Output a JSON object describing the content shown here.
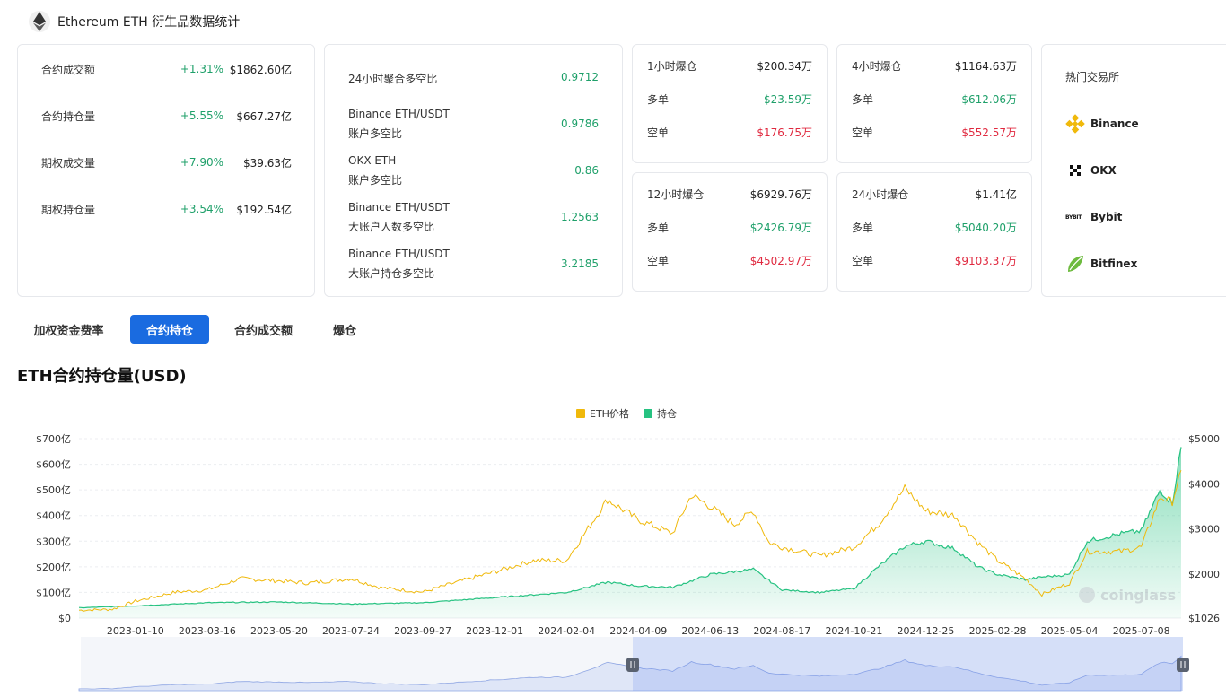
{
  "header": {
    "title": "Ethereum ETH 衍生品数据统计"
  },
  "stats": [
    {
      "label": "合约成交额",
      "change": "+1.31%",
      "value": "$1862.60亿"
    },
    {
      "label": "合约持仓量",
      "change": "+5.55%",
      "value": "$667.27亿"
    },
    {
      "label": "期权成交量",
      "change": "+7.90%",
      "value": "$39.63亿"
    },
    {
      "label": "期权持仓量",
      "change": "+3.54%",
      "value": "$192.54亿"
    }
  ],
  "ratios": [
    {
      "line1": "24小时聚合多空比",
      "line2": "",
      "value": "0.9712"
    },
    {
      "line1": "Binance ETH/USDT",
      "line2": "账户多空比",
      "value": "0.9786"
    },
    {
      "line1": "OKX ETH",
      "line2": "账户多空比",
      "value": "0.86"
    },
    {
      "line1": "Binance ETH/USDT",
      "line2": "大账户人数多空比",
      "value": "1.2563"
    },
    {
      "line1": "Binance ETH/USDT",
      "line2": "大账户持仓多空比",
      "value": "3.2185"
    }
  ],
  "liquidations": [
    {
      "title": "1小时爆仓",
      "total": "$200.34万",
      "long_label": "多单",
      "long": "$23.59万",
      "short_label": "空单",
      "short": "$176.75万"
    },
    {
      "title": "4小时爆仓",
      "total": "$1164.63万",
      "long_label": "多单",
      "long": "$612.06万",
      "short_label": "空单",
      "short": "$552.57万"
    },
    {
      "title": "12小时爆仓",
      "total": "$6929.76万",
      "long_label": "多单",
      "long": "$2426.79万",
      "short_label": "空单",
      "short": "$4502.97万"
    },
    {
      "title": "24小时爆仓",
      "total": "$1.41亿",
      "long_label": "多单",
      "long": "$5040.20万",
      "short_label": "空单",
      "short": "$9103.37万"
    }
  ],
  "exchanges": {
    "title": "热门交易所",
    "items": [
      {
        "name": "Binance",
        "icon": "binance-icon"
      },
      {
        "name": "OKX",
        "icon": "okx-icon"
      },
      {
        "name": "Bybit",
        "icon": "bybit-icon",
        "logo_text": "BYBIT"
      },
      {
        "name": "Bitfinex",
        "icon": "bitfinex-icon"
      }
    ]
  },
  "tabs": [
    {
      "label": "加权资金费率",
      "active": false
    },
    {
      "label": "合约持仓",
      "active": true
    },
    {
      "label": "合约成交额",
      "active": false
    },
    {
      "label": "爆仓",
      "active": false
    }
  ],
  "chart_title": "ETH合约持仓量(USD)",
  "colors": {
    "price": "#f0b90b",
    "oi": "#26c281",
    "accent": "#1a6be0",
    "green": "#1fa06a",
    "red": "#e0293f"
  },
  "watermark": "coinglass",
  "chart_data": {
    "type": "area",
    "legend": [
      "ETH价格",
      "持仓"
    ],
    "legend_position": "top-center",
    "x_ticks": [
      "2023-01-10",
      "2023-03-16",
      "2023-05-20",
      "2023-07-24",
      "2023-09-27",
      "2023-12-01",
      "2024-02-04",
      "2024-04-09",
      "2024-06-13",
      "2024-08-17",
      "2024-10-21",
      "2024-12-25",
      "2025-02-28",
      "2025-05-04",
      "2025-07-08"
    ],
    "y_left_ticks": [
      "$0",
      "$100亿",
      "$200亿",
      "$300亿",
      "$400亿",
      "$500亿",
      "$600亿",
      "$700亿"
    ],
    "y_right_ticks": [
      "$1026",
      "$2000",
      "$3000",
      "$4000",
      "$5000"
    ],
    "y_left_range": [
      0,
      700
    ],
    "y_left_unit": "亿",
    "y_right_range": [
      1026,
      5000
    ],
    "x_range": [
      "2022-11-20",
      "2025-08-13"
    ],
    "series": [
      {
        "name": "ETH价格",
        "axis": "right",
        "x": [
          "2022-11-20",
          "2022-12-20",
          "2023-01-10",
          "2023-02-15",
          "2023-03-16",
          "2023-04-15",
          "2023-05-20",
          "2023-06-15",
          "2023-07-24",
          "2023-08-20",
          "2023-09-27",
          "2023-10-25",
          "2023-12-01",
          "2024-01-05",
          "2024-02-04",
          "2024-03-12",
          "2024-04-09",
          "2024-05-10",
          "2024-05-27",
          "2024-06-13",
          "2024-07-05",
          "2024-07-22",
          "2024-08-05",
          "2024-08-17",
          "2024-09-20",
          "2024-10-21",
          "2024-11-12",
          "2024-12-06",
          "2024-12-25",
          "2025-01-20",
          "2025-02-10",
          "2025-02-28",
          "2025-03-25",
          "2025-04-09",
          "2025-05-04",
          "2025-05-20",
          "2025-06-20",
          "2025-07-08",
          "2025-07-25",
          "2025-08-05",
          "2025-08-13"
        ],
        "y": [
          1200,
          1220,
          1400,
          1600,
          1650,
          1900,
          1850,
          1800,
          1900,
          1700,
          1600,
          1800,
          2050,
          2300,
          2300,
          3650,
          3200,
          2900,
          3750,
          3500,
          3100,
          3400,
          2700,
          2600,
          2400,
          2600,
          3100,
          3900,
          3400,
          3300,
          2700,
          2300,
          1900,
          1550,
          1800,
          2500,
          2500,
          2600,
          3700,
          3600,
          4300
        ]
      },
      {
        "name": "持仓",
        "axis": "left",
        "x": [
          "2022-11-20",
          "2023-01-10",
          "2023-03-16",
          "2023-05-20",
          "2023-07-24",
          "2023-09-27",
          "2023-12-01",
          "2024-02-04",
          "2024-03-12",
          "2024-04-09",
          "2024-05-10",
          "2024-06-13",
          "2024-07-22",
          "2024-08-17",
          "2024-09-20",
          "2024-10-21",
          "2024-11-12",
          "2024-12-06",
          "2024-12-25",
          "2025-01-20",
          "2025-02-10",
          "2025-02-28",
          "2025-03-25",
          "2025-04-09",
          "2025-05-04",
          "2025-05-20",
          "2025-06-20",
          "2025-07-08",
          "2025-07-25",
          "2025-08-05",
          "2025-08-13"
        ],
        "y": [
          40,
          48,
          60,
          63,
          55,
          60,
          80,
          100,
          140,
          125,
          120,
          170,
          190,
          110,
          100,
          115,
          200,
          280,
          300,
          270,
          200,
          170,
          150,
          160,
          170,
          300,
          330,
          340,
          500,
          450,
          667
        ]
      }
    ]
  }
}
